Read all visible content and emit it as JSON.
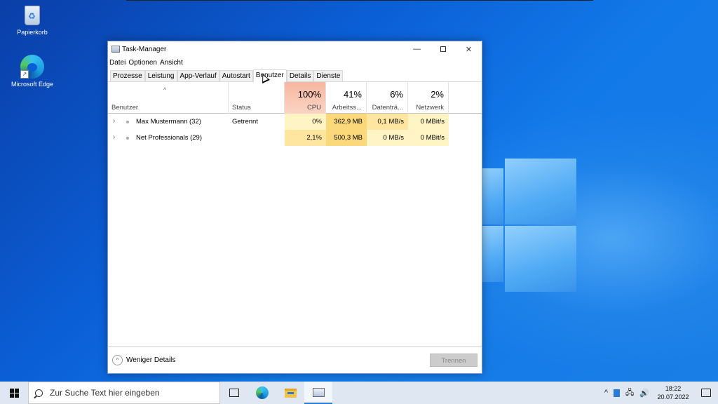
{
  "desktop": {
    "icons": [
      {
        "label": "Papierkorb"
      },
      {
        "label": "Microsoft Edge"
      }
    ]
  },
  "window": {
    "title": "Task-Manager",
    "menu": [
      "Datei",
      "Optionen",
      "Ansicht"
    ],
    "tabs": [
      "Prozesse",
      "Leistung",
      "App-Verlauf",
      "Autostart",
      "Benutzer",
      "Details",
      "Dienste"
    ],
    "active_tab": "Benutzer",
    "columns": {
      "user": {
        "label": "Benutzer"
      },
      "status": {
        "label": "Status"
      },
      "cpu": {
        "pct": "100%",
        "label": "CPU"
      },
      "mem": {
        "pct": "41%",
        "label": "Arbeitss..."
      },
      "disk": {
        "pct": "6%",
        "label": "Datenträ..."
      },
      "net": {
        "pct": "2%",
        "label": "Netzwerk"
      }
    },
    "rows": [
      {
        "user": "Max Mustermann (32)",
        "status": "Getrennt",
        "cpu": "0%",
        "mem": "362,9 MB",
        "disk": "0,1 MB/s",
        "net": "0 MBit/s"
      },
      {
        "user": "Net Professionals (29)",
        "status": "",
        "cpu": "2,1%",
        "mem": "500,3 MB",
        "disk": "0 MB/s",
        "net": "0 MBit/s"
      }
    ],
    "footer": {
      "less_details": "Weniger Details",
      "disconnect": "Trennen"
    }
  },
  "taskbar": {
    "search_placeholder": "Zur Suche Text hier eingeben",
    "time": "18:22",
    "date": "20.07.2022"
  },
  "colors": {
    "cpu_header": "#f6b7a0",
    "cell_light": "#fff4c4",
    "cell_mid": "#ffe6a0",
    "cell_strong": "#fbd97a"
  }
}
